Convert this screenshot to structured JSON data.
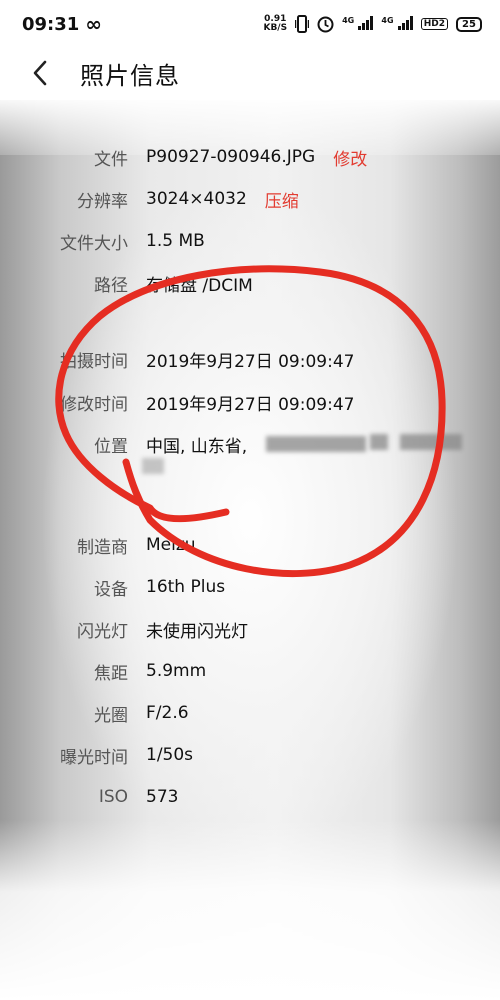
{
  "status_bar": {
    "time": "09:31",
    "infinity": "∞",
    "speed_value": "0.91",
    "speed_unit": "KB/S",
    "net1": "4G",
    "net2": "4G",
    "hd": "HD2",
    "battery": "25"
  },
  "header": {
    "title": "照片信息"
  },
  "info": [
    {
      "label": "文件",
      "value": "P90927-090946.JPG",
      "action": "修改"
    },
    {
      "label": "分辨率",
      "value": "3024×4032",
      "action": "压缩"
    },
    {
      "label": "文件大小",
      "value": "1.5 MB"
    },
    {
      "label": "路径",
      "value": "存储盘 /DCIM"
    },
    {
      "label": "拍摄时间",
      "value": "2019年9月27日 09:09:47"
    },
    {
      "label": "修改时间",
      "value": "2019年9月27日 09:09:47"
    },
    {
      "label": "位置",
      "value": "中国, 山东省,"
    },
    {
      "label": "制造商",
      "value": "Meizu"
    },
    {
      "label": "设备",
      "value": "16th Plus"
    },
    {
      "label": "闪光灯",
      "value": "未使用闪光灯"
    },
    {
      "label": "焦距",
      "value": "5.9mm"
    },
    {
      "label": "光圈",
      "value": "F/2.6"
    },
    {
      "label": "曝光时间",
      "value": "1/50s"
    },
    {
      "label": "ISO",
      "value": "573"
    }
  ],
  "colors": {
    "action": "#e23b30",
    "annotation": "#e52d22"
  },
  "icons": {
    "back": "chevron-left-icon",
    "infinity": "infinity-icon",
    "vibrate": "vibrate-icon",
    "alarm": "alarm-icon",
    "signal": "signal-icon",
    "battery": "battery-icon"
  }
}
